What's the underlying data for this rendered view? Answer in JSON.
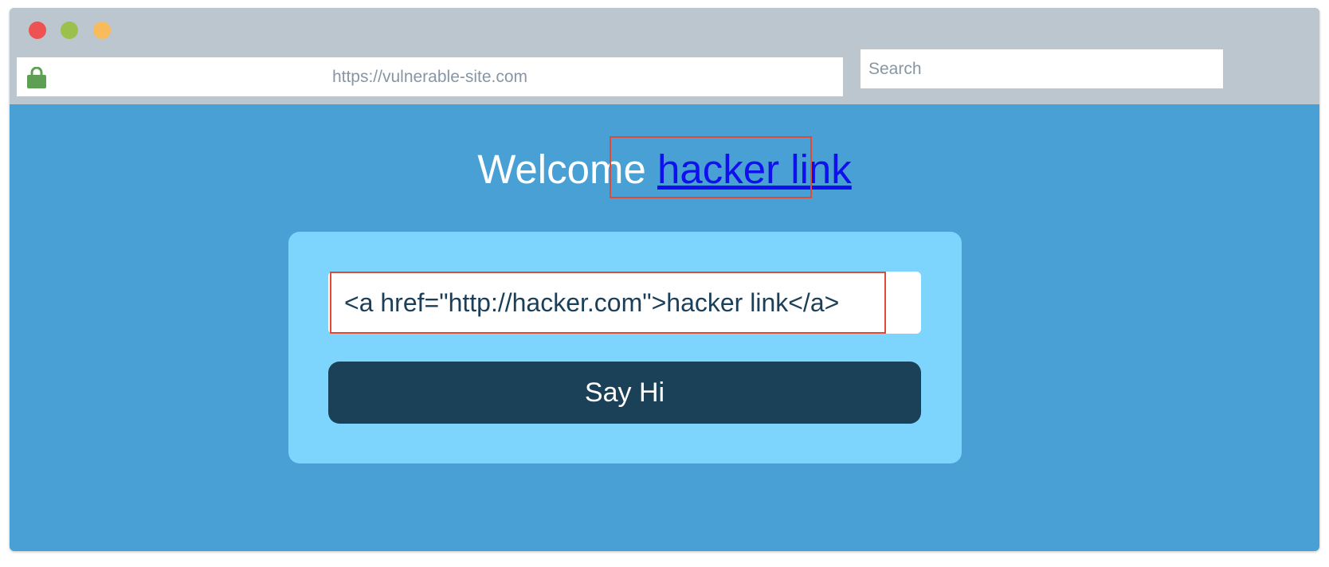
{
  "browser": {
    "address": "https://vulnerable-site.com",
    "search_placeholder": "Search",
    "traffic_lights": {
      "close": "#ee5252",
      "minimize": "#9bc04c",
      "maximize": "#f7bb5c"
    },
    "lock_icon": "lock-icon",
    "lock_color": "#5f9f55"
  },
  "page": {
    "greeting": "Welcome",
    "link_text": "hacker link",
    "input_value": "<a href=\"http://hacker.com\">hacker link</a>",
    "button_label": "Say Hi",
    "background_color": "#48a0d4",
    "card_color": "#7dd4fc",
    "button_color": "#1a4157",
    "highlight_color": "#e04b35"
  }
}
